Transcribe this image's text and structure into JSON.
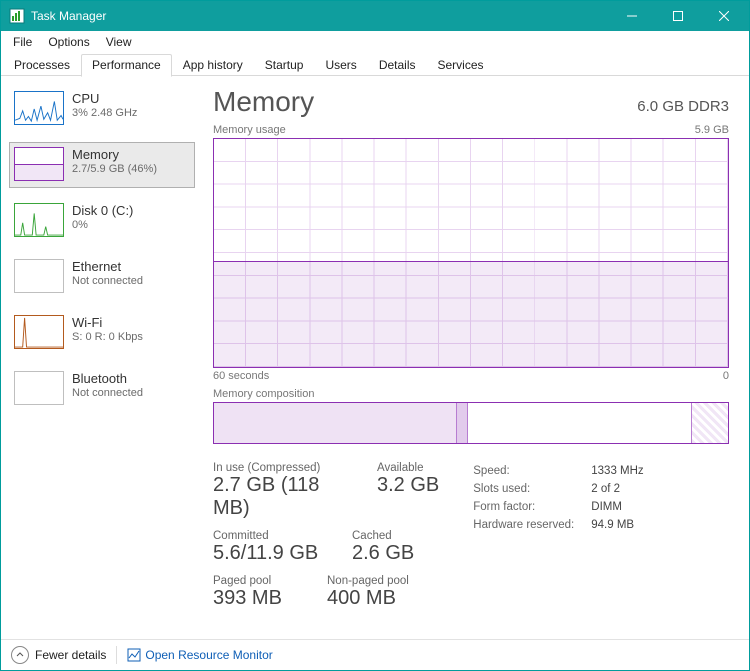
{
  "window": {
    "title": "Task Manager"
  },
  "menu": {
    "file": "File",
    "options": "Options",
    "view": "View"
  },
  "tabs": {
    "processes": "Processes",
    "performance": "Performance",
    "app_history": "App history",
    "startup": "Startup",
    "users": "Users",
    "details": "Details",
    "services": "Services"
  },
  "sidebar": {
    "items": [
      {
        "name": "CPU",
        "sub": "3% 2.48 GHz"
      },
      {
        "name": "Memory",
        "sub": "2.7/5.9 GB (46%)"
      },
      {
        "name": "Disk 0 (C:)",
        "sub": "0%"
      },
      {
        "name": "Ethernet",
        "sub": "Not connected"
      },
      {
        "name": "Wi-Fi",
        "sub": "S: 0 R: 0 Kbps"
      },
      {
        "name": "Bluetooth",
        "sub": "Not connected"
      }
    ]
  },
  "main": {
    "title": "Memory",
    "subtitle": "6.0 GB DDR3",
    "chart": {
      "label": "Memory usage",
      "max_label": "5.9 GB",
      "x_left": "60 seconds",
      "x_right": "0"
    },
    "composition_label": "Memory composition",
    "stats": {
      "in_use_label": "In use (Compressed)",
      "in_use_value": "2.7 GB (118 MB)",
      "available_label": "Available",
      "available_value": "3.2 GB",
      "committed_label": "Committed",
      "committed_value": "5.6/11.9 GB",
      "cached_label": "Cached",
      "cached_value": "2.6 GB",
      "paged_label": "Paged pool",
      "paged_value": "393 MB",
      "nonpaged_label": "Non-paged pool",
      "nonpaged_value": "400 MB"
    },
    "kv": [
      {
        "key": "Speed:",
        "val": "1333 MHz"
      },
      {
        "key": "Slots used:",
        "val": "2 of 2"
      },
      {
        "key": "Form factor:",
        "val": "DIMM"
      },
      {
        "key": "Hardware reserved:",
        "val": "94.9 MB"
      }
    ]
  },
  "footer": {
    "fewer": "Fewer details",
    "resmon": "Open Resource Monitor"
  },
  "chart_data": {
    "type": "line",
    "title": "Memory usage",
    "xlabel": "seconds ago",
    "ylabel": "GB",
    "x": [
      60,
      55,
      50,
      45,
      40,
      35,
      30,
      25,
      20,
      15,
      10,
      5,
      0
    ],
    "series": [
      {
        "name": "Memory in use",
        "values": [
          2.7,
          2.7,
          2.7,
          2.7,
          2.7,
          2.7,
          2.7,
          2.7,
          2.7,
          2.7,
          2.7,
          2.7,
          2.7
        ]
      }
    ],
    "ylim": [
      0,
      5.9
    ]
  }
}
